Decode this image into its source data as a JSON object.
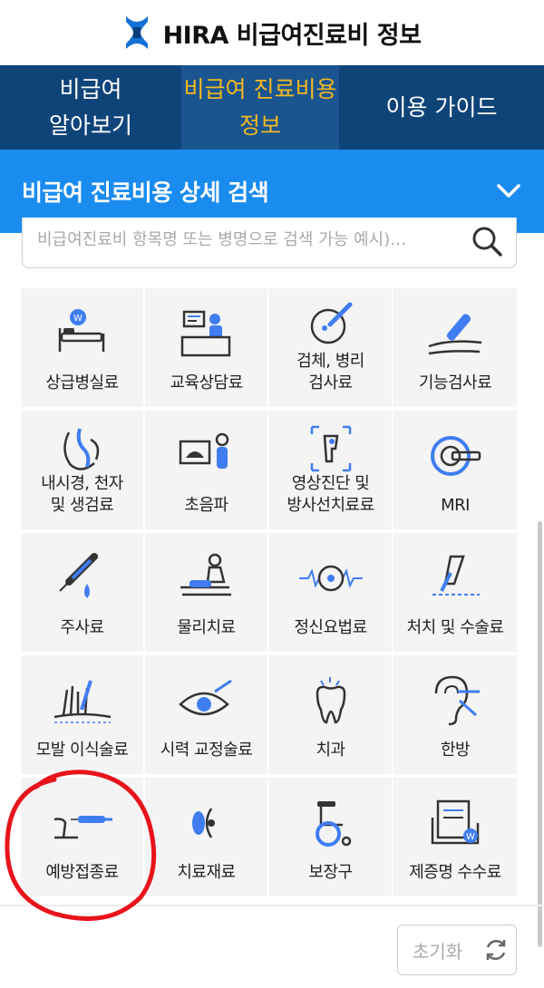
{
  "header": {
    "title": "HIRA 비급여진료비 정보",
    "logo_icon": "hira-logo-icon"
  },
  "nav": {
    "tabs": [
      {
        "label": "비급여\n알아보기",
        "active": false
      },
      {
        "label": "비급여 진료비용\n정보",
        "active": true
      },
      {
        "label": "이용 가이드",
        "active": false
      }
    ]
  },
  "section": {
    "title": "비급여 진료비용 상세 검색",
    "toggle_icon": "chevron-down-icon"
  },
  "search": {
    "placeholder": "비급여진료비 항목명 또는 병명으로 검색 가능 예시)…",
    "icon": "search-icon"
  },
  "categories": [
    {
      "label": "상급병실료",
      "icon": "hospital-bed-icon"
    },
    {
      "label": "교육상담료",
      "icon": "counseling-desk-icon"
    },
    {
      "label": "검체, 병리\n검사료",
      "icon": "specimen-test-icon"
    },
    {
      "label": "기능검사료",
      "icon": "function-test-icon"
    },
    {
      "label": "내시경, 천자\n및 생검료",
      "icon": "endoscope-icon"
    },
    {
      "label": "초음파",
      "icon": "ultrasound-icon"
    },
    {
      "label": "영상진단 및\n방사선치료료",
      "icon": "radiology-icon"
    },
    {
      "label": "MRI",
      "icon": "mri-icon"
    },
    {
      "label": "주사료",
      "icon": "syringe-icon"
    },
    {
      "label": "물리치료",
      "icon": "physical-therapy-icon"
    },
    {
      "label": "정신요법료",
      "icon": "brain-wave-icon"
    },
    {
      "label": "처치 및 수술료",
      "icon": "surgery-icon"
    },
    {
      "label": "모발 이식술료",
      "icon": "hair-transplant-icon"
    },
    {
      "label": "시력 교정술료",
      "icon": "eye-correction-icon"
    },
    {
      "label": "치과",
      "icon": "tooth-icon"
    },
    {
      "label": "한방",
      "icon": "acupuncture-ear-icon"
    },
    {
      "label": "예방접종료",
      "icon": "vaccination-icon"
    },
    {
      "label": "치료재료",
      "icon": "lens-material-icon"
    },
    {
      "label": "보장구",
      "icon": "wheelchair-icon"
    },
    {
      "label": "제증명 수수료",
      "icon": "certificate-icon"
    }
  ],
  "footer": {
    "reset_label": "초기화",
    "reset_icon": "refresh-icon"
  },
  "colors": {
    "nav_bg": "#0f4479",
    "active_tab_text": "#f2b820",
    "section_bg": "#1a8cf0",
    "icon_blue": "#3f7df0",
    "annotation": "#e8141c"
  }
}
